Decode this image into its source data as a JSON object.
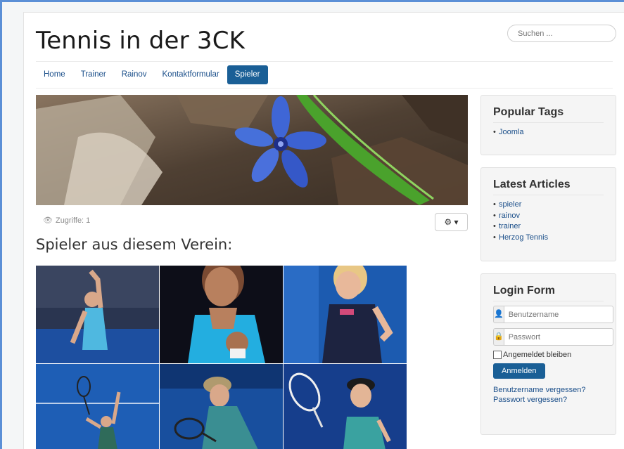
{
  "site": {
    "title": "Tennis in der 3CK"
  },
  "search": {
    "placeholder": "Suchen ..."
  },
  "nav": {
    "items": [
      {
        "label": "Home"
      },
      {
        "label": "Trainer"
      },
      {
        "label": "Rainov"
      },
      {
        "label": "Kontaktformular"
      },
      {
        "label": "Spieler",
        "active": true
      }
    ]
  },
  "article": {
    "views_label": "Zugriffe: 1",
    "heading": "Spieler aus diesem Verein:"
  },
  "sidebar": {
    "popular_tags": {
      "title": "Popular Tags",
      "items": [
        "Joomla"
      ]
    },
    "latest_articles": {
      "title": "Latest Articles",
      "items": [
        "spieler",
        "rainov",
        "trainer",
        "Herzog Tennis"
      ]
    },
    "login": {
      "title": "Login Form",
      "username_placeholder": "Benutzername",
      "password_placeholder": "Passwort",
      "remember_label": "Angemeldet bleiben",
      "submit_label": "Anmelden",
      "forgot_username": "Benutzername vergessen?",
      "forgot_password": "Passwort vergessen?"
    }
  },
  "colors": {
    "accent": "#1a5f96",
    "link": "#1b4f8a",
    "frame": "#5b8fd6"
  }
}
